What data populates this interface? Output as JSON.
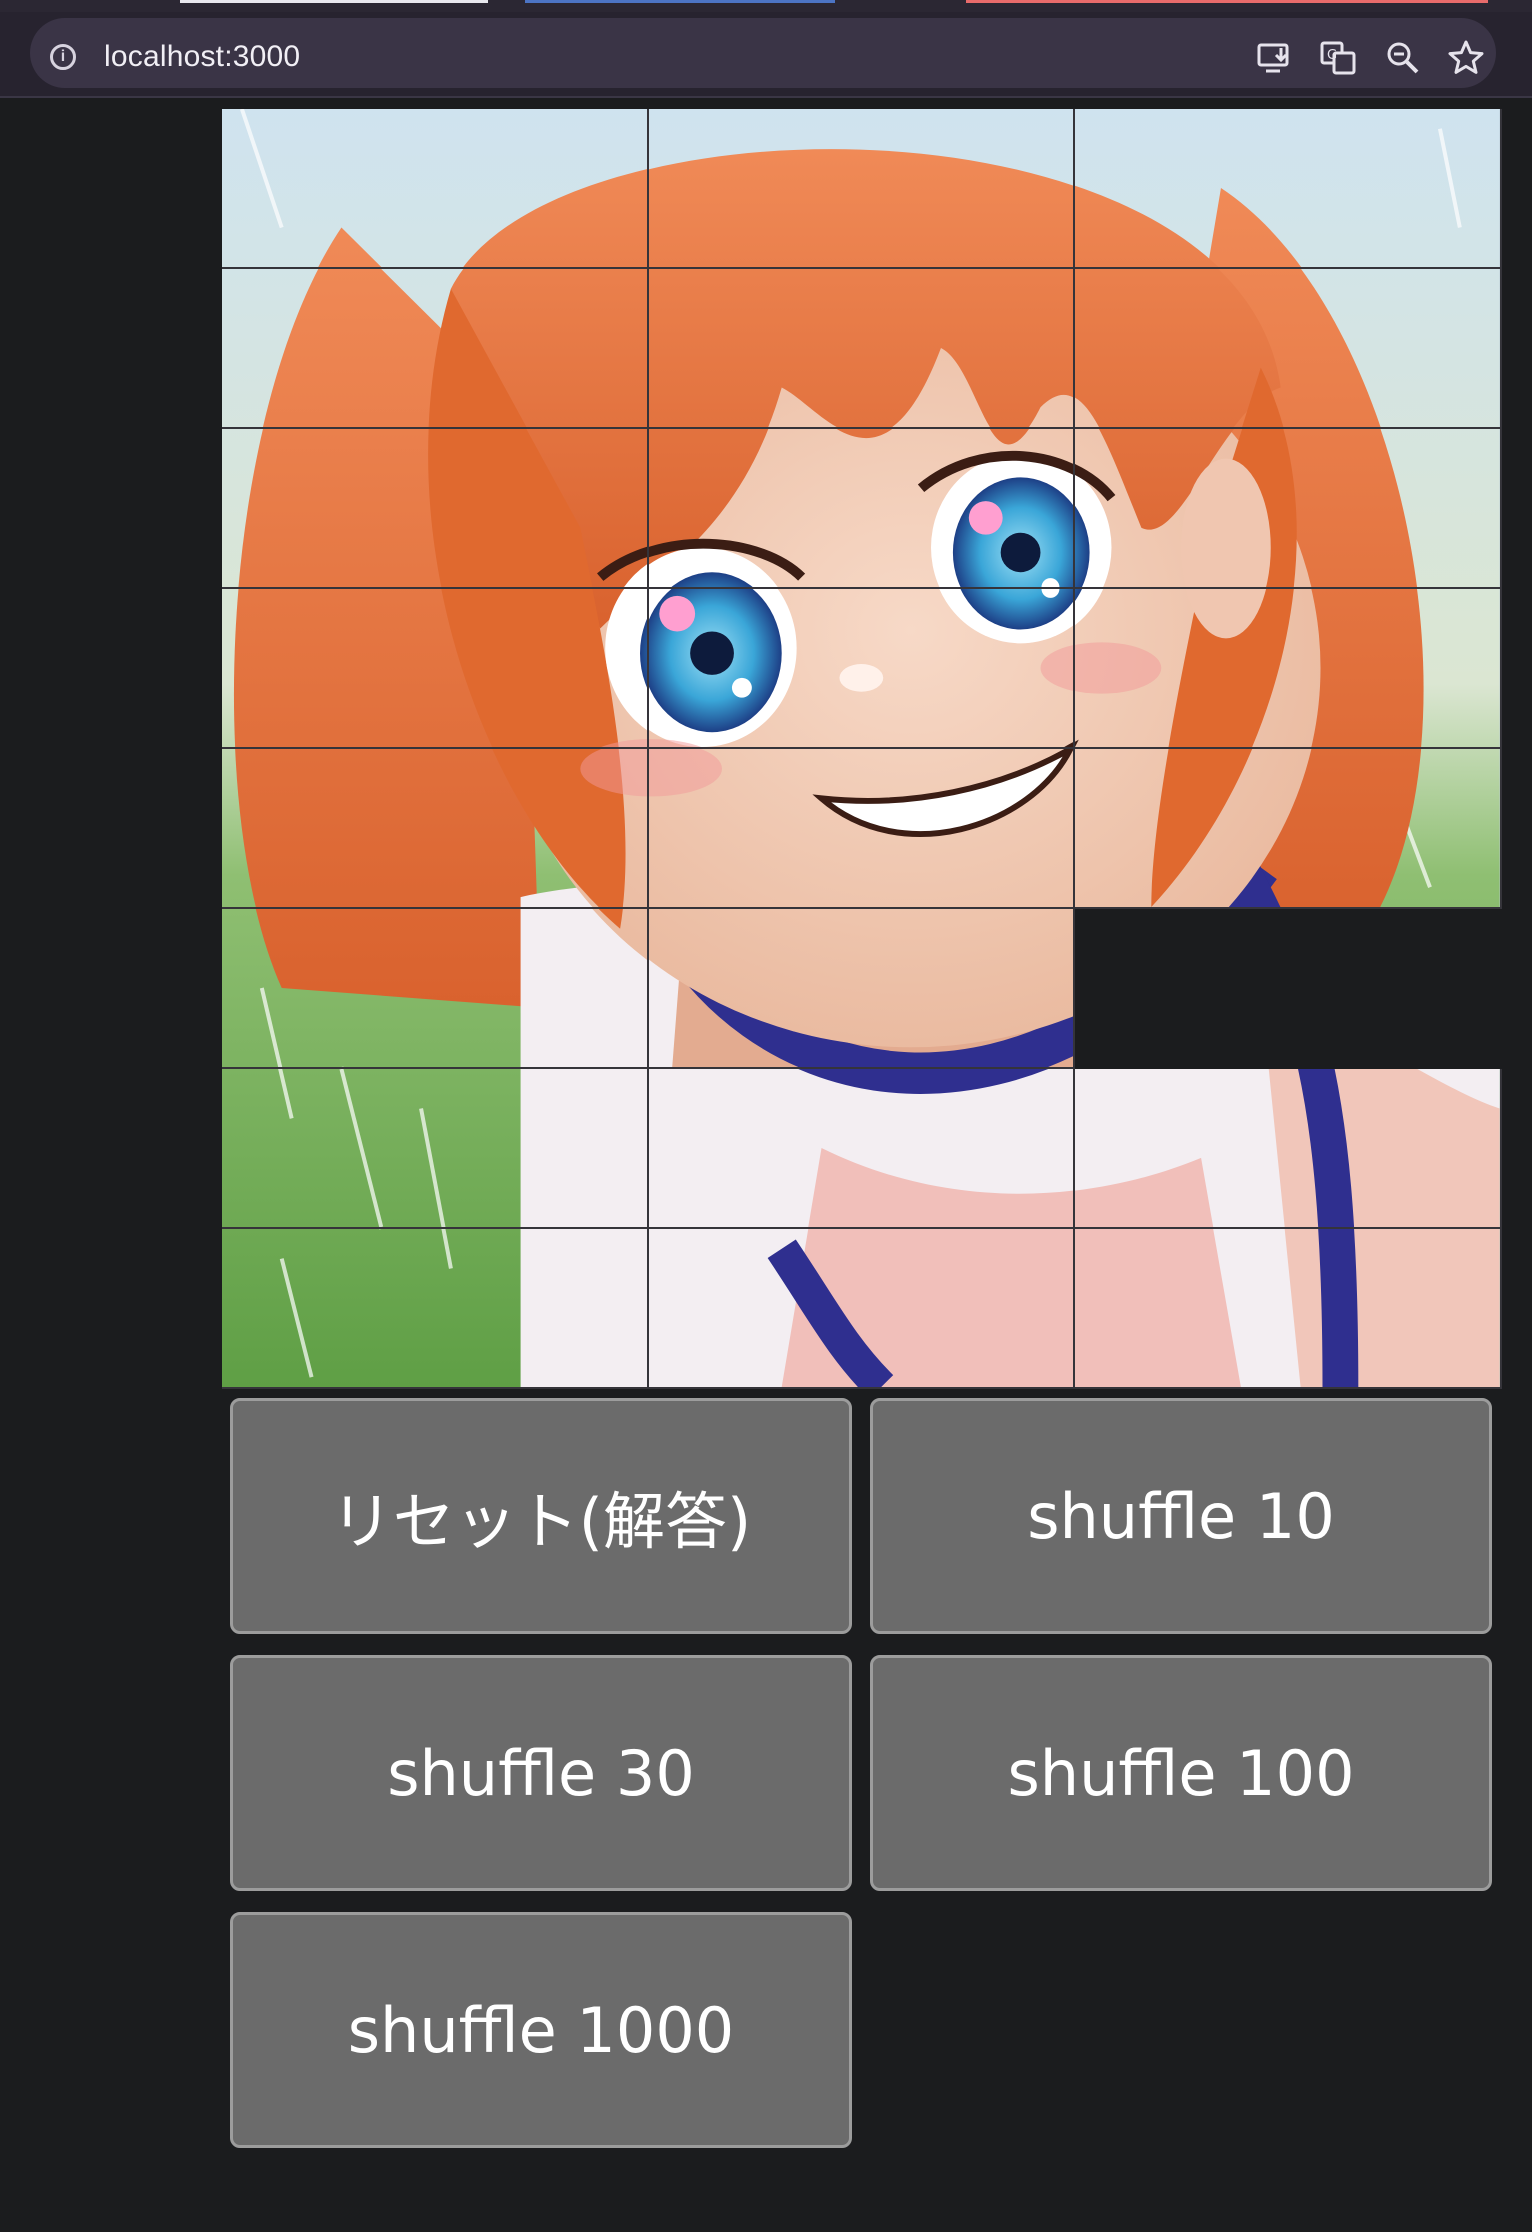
{
  "browser": {
    "url": "localhost:3000",
    "icons": [
      "info-icon",
      "install-app-icon",
      "translate-icon",
      "zoom-icon",
      "bookmark-star-icon"
    ]
  },
  "puzzle": {
    "columns": 3,
    "rows": 8,
    "empty_tile": {
      "row": 6,
      "col": 3
    }
  },
  "buttons": {
    "reset": "リセット(解答)",
    "shuffle_10": "shuffle 10",
    "shuffle_30": "shuffle 30",
    "shuffle_100": "shuffle 100",
    "shuffle_1000": "shuffle 1000"
  },
  "colors": {
    "page_bg": "#1b1c1e",
    "button_bg": "#6b6b6b",
    "hair": "#e8733f",
    "eye": "#3aa6d8",
    "shirt_trim": "#2f2f8f"
  }
}
